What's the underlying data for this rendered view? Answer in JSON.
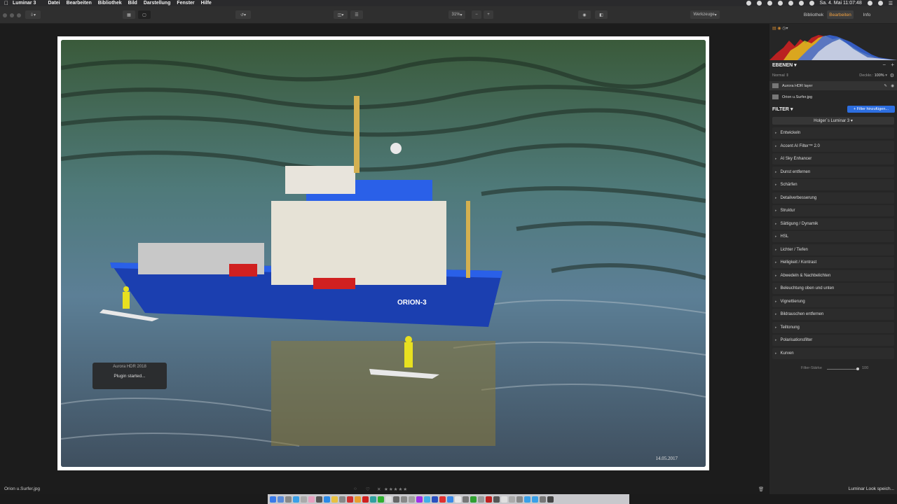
{
  "menubar": {
    "app_name": "Luminar 3",
    "items": [
      "Datei",
      "Bearbeiten",
      "Bibliothek",
      "Bild",
      "Darstellung",
      "Fenster",
      "Hilfe"
    ],
    "clock": "Sa. 4. Mai  11:07:48"
  },
  "toolbar": {
    "zoom": "31%",
    "zoom_out": "−",
    "zoom_in": "+",
    "tools_label": "Werkzeuge",
    "tabs": [
      "Bibliothek",
      "Bearbeiten",
      "Info"
    ],
    "active_tab": "Bearbeiten"
  },
  "photo": {
    "watermark_date": "14.05.2017",
    "boat_name": "ORION-3"
  },
  "plugin_toast": {
    "title": "Aurora HDR 2018",
    "message": "Plugin started..."
  },
  "status": {
    "filename": "Orion u.Surfer.jpg",
    "look_save": "Luminar Look speich..."
  },
  "sidebar": {
    "layers_title": "EBENEN",
    "blend_mode": "Normal",
    "opacity_label": "Deckkr.:",
    "opacity_value": "100%",
    "layers": [
      {
        "name": "Aurora HDR layer",
        "selected": true
      },
      {
        "name": "Orion u.Surfer.jpg",
        "selected": false
      }
    ],
    "filter_title": "FILTER",
    "add_filter": "+ Filter hinzufügen...",
    "preset": "Holger´s Luminar 3",
    "filters": [
      "Entwickeln",
      "Accent AI Filter™ 2.0",
      "AI Sky Enhancer",
      "Dunst entfernen",
      "Schärfen",
      "Detailverbesserung",
      "Struktur",
      "Sättigung / Dynamik",
      "HSL",
      "Lichter / Tiefen",
      "Helligkeit / Kontrast",
      "Abwedeln & Nachbelichten",
      "Beleuchtung oben und unten",
      "Vignettierung",
      "Bildrauschen entfernen",
      "Teiltonung",
      "Polarisationsfilter",
      "Kurven"
    ],
    "filter_strength_label": "Filter-Stärke",
    "filter_strength_value": "100"
  },
  "colors": {
    "accent_orange": "#f0a040",
    "button_blue": "#2d6ee0",
    "panel_bg": "#262626"
  }
}
